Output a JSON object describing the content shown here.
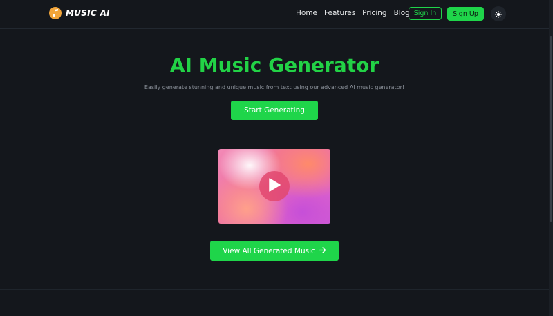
{
  "brand": {
    "name": "MUSIC AI",
    "logo_icon": "music-note-icon",
    "logo_color": "#f2a53a"
  },
  "nav": {
    "items": [
      {
        "label": "Home"
      },
      {
        "label": "Features"
      },
      {
        "label": "Pricing"
      },
      {
        "label": "Blog"
      }
    ],
    "sign_in": "Sign In",
    "sign_up": "Sign Up",
    "theme_icon": "sun-icon"
  },
  "hero": {
    "title": "AI Music Generator",
    "subtitle": "Easily generate stunning and unique music from text using our advanced AI music generator!",
    "cta_label": "Start Generating",
    "video_icon": "play-icon",
    "view_all_label": "View All Generated Music",
    "view_all_icon": "arrow-right-icon"
  },
  "colors": {
    "accent": "#1fd54a",
    "background": "#14171c"
  }
}
